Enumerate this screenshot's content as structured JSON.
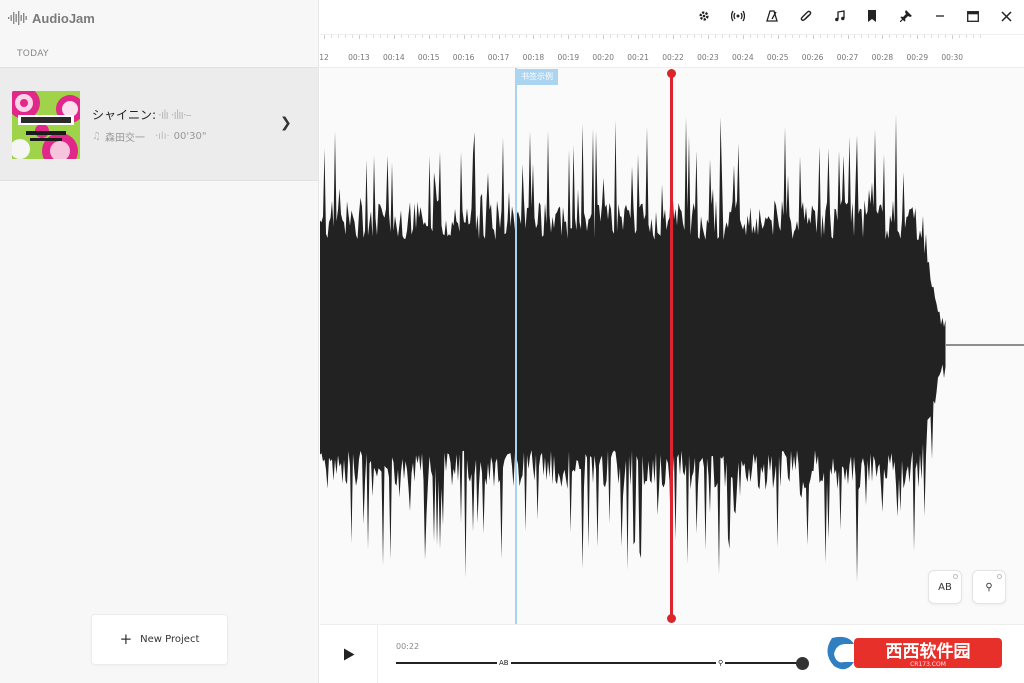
{
  "app": {
    "name": "AudioJam"
  },
  "sidebar": {
    "section_label": "TODAY",
    "project": {
      "title": "シャイニン:",
      "title_fade": "·ılı  ·ılıı·–",
      "artist": "森田交一",
      "duration": "00'30\""
    },
    "new_project_label": "New Project"
  },
  "toolbar": {
    "icons": [
      "gear-icon",
      "broadcast-icon",
      "metronome-icon",
      "paperclip-icon",
      "music-note-icon",
      "bookmark-icon",
      "pin-icon",
      "minimize-icon",
      "maximize-icon",
      "close-icon"
    ]
  },
  "ruler": {
    "labels": [
      "12",
      "00:13",
      "00:14",
      "00:15",
      "00:16",
      "00:17",
      "00:18",
      "00:19",
      "00:20",
      "00:21",
      "00:22",
      "00:23",
      "00:24",
      "00:25",
      "00:26",
      "00:27",
      "00:28",
      "00:29",
      "00:30"
    ]
  },
  "waveform": {
    "bookmark_label": "书签示例",
    "ab_button_label": "AB",
    "pin_button_label": "⚲"
  },
  "transport": {
    "current_time": "00:22",
    "ab_marker": "AB",
    "pin_marker": "⚲"
  },
  "colors": {
    "playhead": "#d8262c",
    "bookmark": "#a8d3ea",
    "waveform": "#222222",
    "watermark_red": "#e8302a"
  },
  "watermark": {
    "text": "西西软件园",
    "sub": "CR173.COM"
  }
}
